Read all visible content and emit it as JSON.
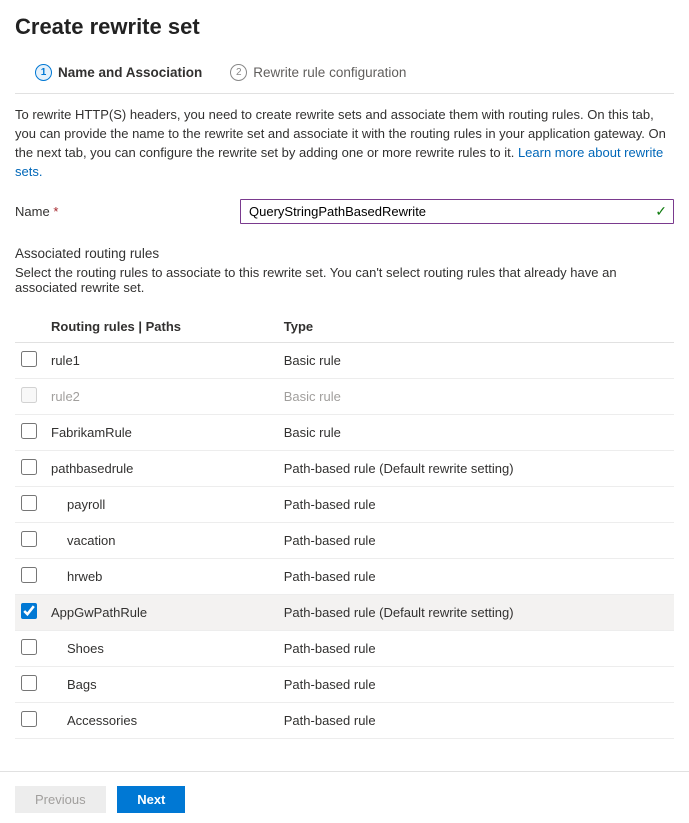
{
  "title": "Create rewrite set",
  "tabs": {
    "active": {
      "num": "1",
      "label": "Name and Association"
    },
    "inactive": {
      "num": "2",
      "label": "Rewrite rule configuration"
    }
  },
  "intro_text": "To rewrite HTTP(S) headers, you need to create rewrite sets and associate them with routing rules. On this tab, you can provide the name to the rewrite set and associate it with the routing rules in your application gateway. On the next tab, you can configure the rewrite set by adding one or more rewrite rules to it.  ",
  "intro_link": "Learn more about rewrite sets.",
  "name_label": "Name",
  "name_value": "QueryStringPathBasedRewrite",
  "assoc_title": "Associated routing rules",
  "assoc_desc": "Select the routing rules to associate to this rewrite set. You can't select routing rules that already have an associated rewrite set.",
  "col_rules": "Routing rules | Paths",
  "col_type": "Type",
  "rows": [
    {
      "name": "rule1",
      "type": "Basic rule",
      "indent": false,
      "checked": false,
      "disabled": false
    },
    {
      "name": "rule2",
      "type": "Basic rule",
      "indent": false,
      "checked": false,
      "disabled": true
    },
    {
      "name": "FabrikamRule",
      "type": "Basic rule",
      "indent": false,
      "checked": false,
      "disabled": false
    },
    {
      "name": "pathbasedrule",
      "type": "Path-based rule (Default rewrite setting)",
      "indent": false,
      "checked": false,
      "disabled": false
    },
    {
      "name": "payroll",
      "type": "Path-based rule",
      "indent": true,
      "checked": false,
      "disabled": false
    },
    {
      "name": "vacation",
      "type": "Path-based rule",
      "indent": true,
      "checked": false,
      "disabled": false
    },
    {
      "name": "hrweb",
      "type": "Path-based rule",
      "indent": true,
      "checked": false,
      "disabled": false
    },
    {
      "name": "AppGwPathRule",
      "type": "Path-based rule (Default rewrite setting)",
      "indent": false,
      "checked": true,
      "disabled": false
    },
    {
      "name": "Shoes",
      "type": "Path-based rule",
      "indent": true,
      "checked": false,
      "disabled": false
    },
    {
      "name": "Bags",
      "type": "Path-based rule",
      "indent": true,
      "checked": false,
      "disabled": false
    },
    {
      "name": "Accessories",
      "type": "Path-based rule",
      "indent": true,
      "checked": false,
      "disabled": false
    }
  ],
  "buttons": {
    "prev": "Previous",
    "next": "Next"
  }
}
